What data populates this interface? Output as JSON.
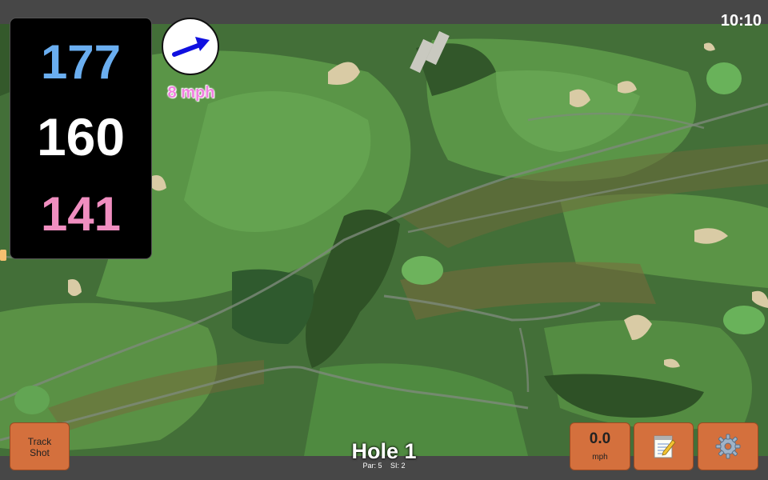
{
  "clock": "10:10",
  "distances": {
    "back": "177",
    "middle": "160",
    "front": "141"
  },
  "wind": {
    "speed_label": "8 mph",
    "direction_icon": "arrow-icon"
  },
  "buttons": {
    "track_shot_line1": "Track",
    "track_shot_line2": "Shot",
    "speed_value": "0.0",
    "speed_unit": "mph",
    "notes_icon": "notepad-icon",
    "settings_icon": "gear-icon"
  },
  "hole": {
    "title": "Hole 1",
    "par": "Par: 5",
    "si": "SI: 2"
  },
  "colors": {
    "back": "#6aaef0",
    "middle": "#ffffff",
    "front": "#f08ec0",
    "button": "#d4703d",
    "wind_text": "#f080e0"
  }
}
